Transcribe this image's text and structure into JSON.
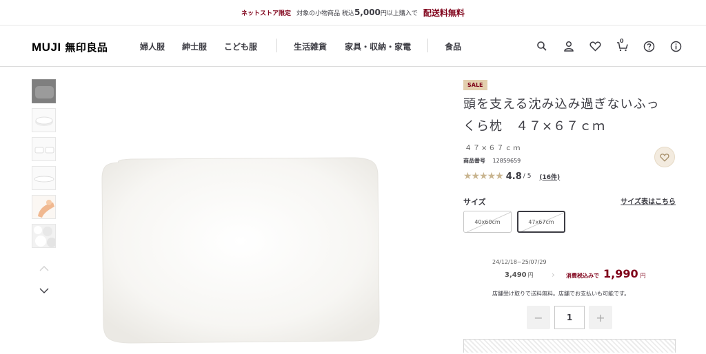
{
  "promo": {
    "store_label": "ネットストア限定",
    "text_before": "対象の小物商品 税込",
    "amount": "5,000",
    "text_after": "円以上購入で",
    "free_shipping": "配送料無料"
  },
  "header": {
    "logo_latin": "MUJI",
    "logo_japanese": "無印良品",
    "nav_items": [
      "婦人服",
      "紳士服",
      "こども服",
      "生活雑貨",
      "家具・収納・家電",
      "食品"
    ],
    "cart_count": "0",
    "icons": [
      "search-icon",
      "user-icon",
      "heart-icon",
      "cart-icon",
      "help-icon",
      "info-icon"
    ]
  },
  "product": {
    "badge": "SALE",
    "title": "頭を支える沈み込み過ぎないふっくら枕　４７×６７ｃｍ",
    "subtitle": "４７×６７ｃｍ",
    "code_label": "商品番号",
    "code": "12859659",
    "rating_value": "4.8",
    "rating_denominator": "/ 5",
    "rating_stars": 4.8,
    "review_count": "(16件)",
    "size_label": "サイズ",
    "size_guide_link": "サイズ表はこちら",
    "sizes": [
      {
        "label": "40x60cm",
        "selected": false
      },
      {
        "label": "47x67cm",
        "selected": true
      }
    ],
    "sale_period": "24/12/18~25/07/29",
    "old_price": "3,490",
    "price_unit": "円",
    "tax_label": "消費税込みで",
    "new_price": "1,990",
    "shipping_note": "店舗受け取りで送料無料。店舗でお支払いも可能です。",
    "quantity": "1",
    "qty_minus": "−",
    "qty_plus": "+"
  },
  "colors": {
    "brand_red": "#7f0019",
    "sale_badge_bg": "#e3cfae",
    "star_color": "#c9b590",
    "text": "#3c3c43"
  }
}
